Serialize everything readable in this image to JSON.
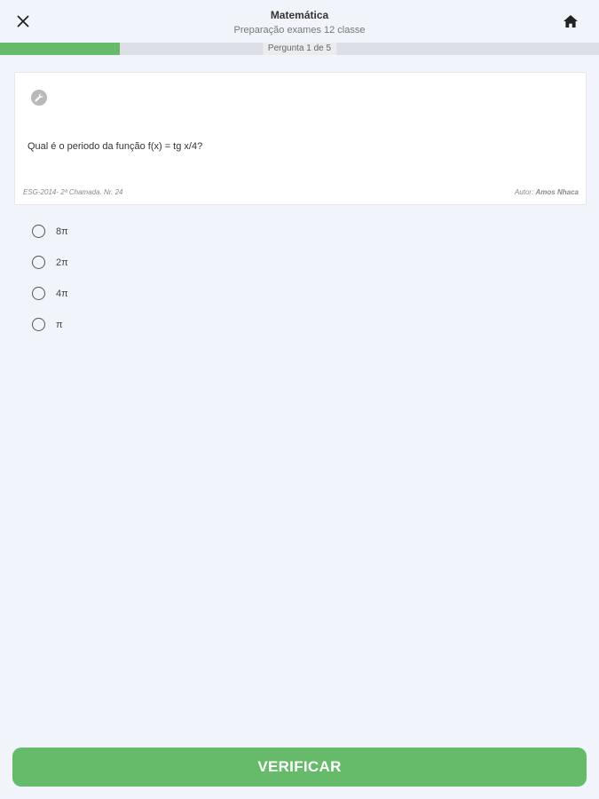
{
  "header": {
    "title": "Matemática",
    "subtitle": "Preparação exames 12 classe",
    "close_icon": "close-icon",
    "home_icon": "home-icon"
  },
  "progress": {
    "label": "Pergunta 1 de 5",
    "current": 1,
    "total": 5,
    "fraction": 0.2,
    "fill_color": "#66bb6a"
  },
  "question": {
    "icon": "wrench-icon",
    "text": "Qual é o periodo da função f(x) = tg x/4?",
    "source": "ESG-2014- 2ª Chamada. Nr. 24",
    "author_prefix": "Autor:",
    "author_name": "Amos Nhaca"
  },
  "options": [
    {
      "label": "8π"
    },
    {
      "label": "2π"
    },
    {
      "label": "4π"
    },
    {
      "label": "π"
    }
  ],
  "actions": {
    "verify_label": "VERIFICAR",
    "accent_color": "#66bb6a"
  }
}
